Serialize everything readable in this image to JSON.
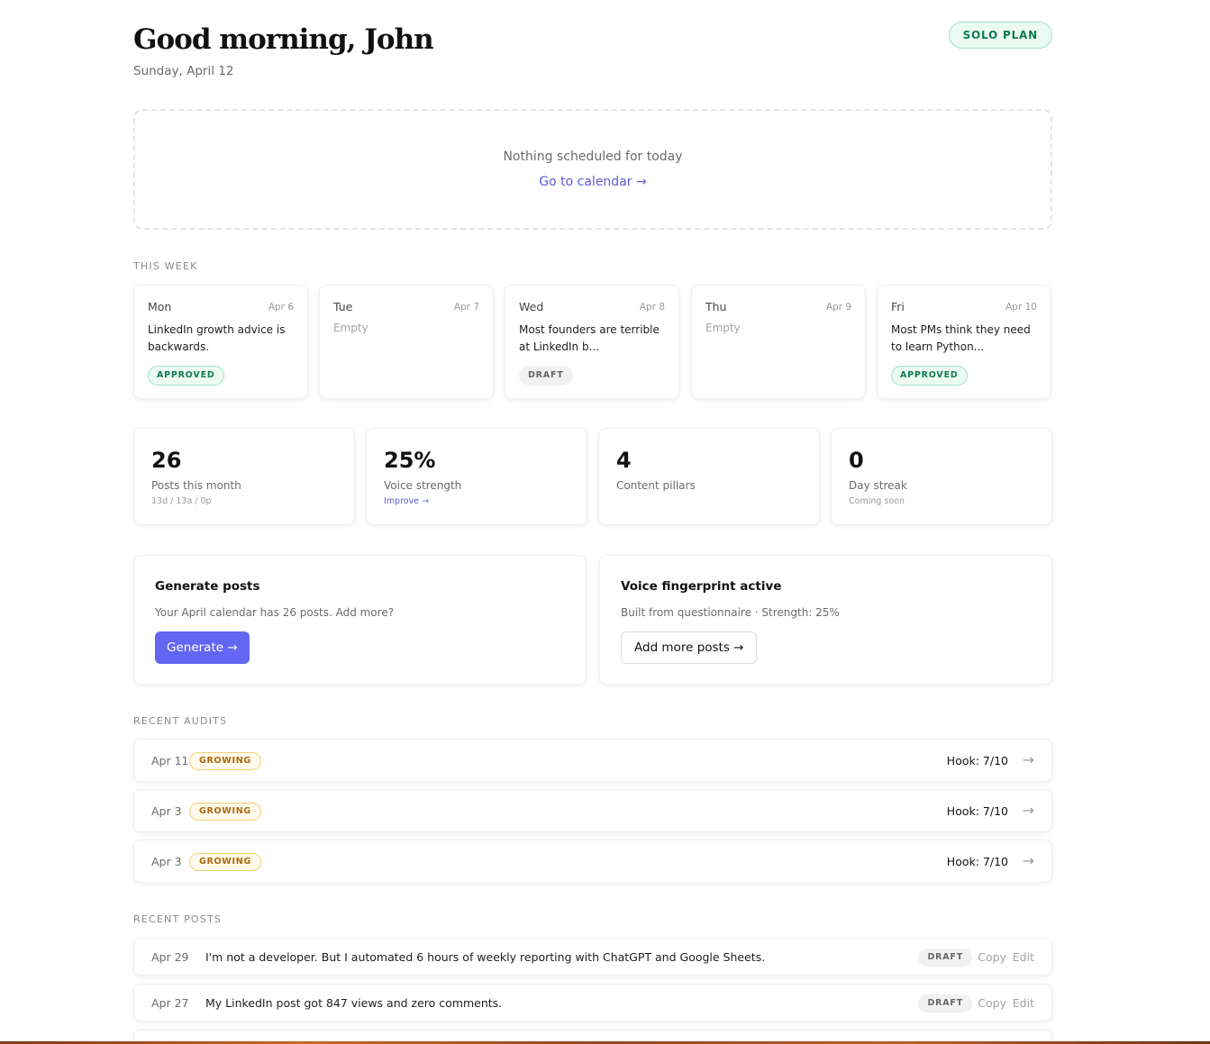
{
  "header": {
    "greeting": "Good morning, John",
    "date": "Sunday, April 12",
    "plan_badge": "SOLO PLAN"
  },
  "today": {
    "empty_text": "Nothing scheduled for today",
    "calendar_link": "Go to calendar →"
  },
  "week": {
    "section_label": "THIS WEEK",
    "days": [
      {
        "day": "Mon",
        "date": "Apr 6",
        "text": "LinkedIn growth advice is backwards.",
        "status": "APPROVED"
      },
      {
        "day": "Tue",
        "date": "Apr 7",
        "text": "Empty",
        "status": ""
      },
      {
        "day": "Wed",
        "date": "Apr 8",
        "text": "Most founders are terrible at LinkedIn b...",
        "status": "DRAFT"
      },
      {
        "day": "Thu",
        "date": "Apr 9",
        "text": "Empty",
        "status": ""
      },
      {
        "day": "Fri",
        "date": "Apr 10",
        "text": "Most PMs think they need to learn Python...",
        "status": "APPROVED"
      }
    ]
  },
  "stats": [
    {
      "value": "26",
      "label": "Posts this month",
      "sub": "13d / 13a / 0p"
    },
    {
      "value": "25%",
      "label": "Voice strength",
      "sub": "Improve →"
    },
    {
      "value": "4",
      "label": "Content pillars",
      "sub": ""
    },
    {
      "value": "0",
      "label": "Day streak",
      "sub": "Coming soon"
    }
  ],
  "generate": {
    "title": "Generate posts",
    "description": "Your April calendar has 26 posts. Add more?",
    "button": "Generate →"
  },
  "voice": {
    "title": "Voice fingerprint active",
    "description": "Built from questionnaire · Strength: 25%",
    "button": "Add more posts →"
  },
  "audits": {
    "section_label": "RECENT AUDITS",
    "items": [
      {
        "date": "Apr 11",
        "badge": "GROWING",
        "score": "Hook: 7/10",
        "arrow": "→"
      },
      {
        "date": "Apr 3",
        "badge": "GROWING",
        "score": "Hook: 7/10",
        "arrow": "→"
      },
      {
        "date": "Apr 3",
        "badge": "GROWING",
        "score": "Hook: 7/10",
        "arrow": "→"
      }
    ]
  },
  "posts": {
    "section_label": "RECENT POSTS",
    "items": [
      {
        "date": "Apr 29",
        "text": "I'm not a developer. But I automated 6 hours of weekly reporting with ChatGPT and Google Sheets.",
        "status": "DRAFT",
        "copy": "Copy",
        "edit": "Edit"
      },
      {
        "date": "Apr 27",
        "text": "My LinkedIn post got 847 views and zero comments.",
        "status": "DRAFT",
        "copy": "Copy",
        "edit": "Edit"
      }
    ]
  },
  "colors": {
    "accent": "#6366f1",
    "approved_green": "#0f7a52",
    "growing_amber": "#b0660a"
  }
}
